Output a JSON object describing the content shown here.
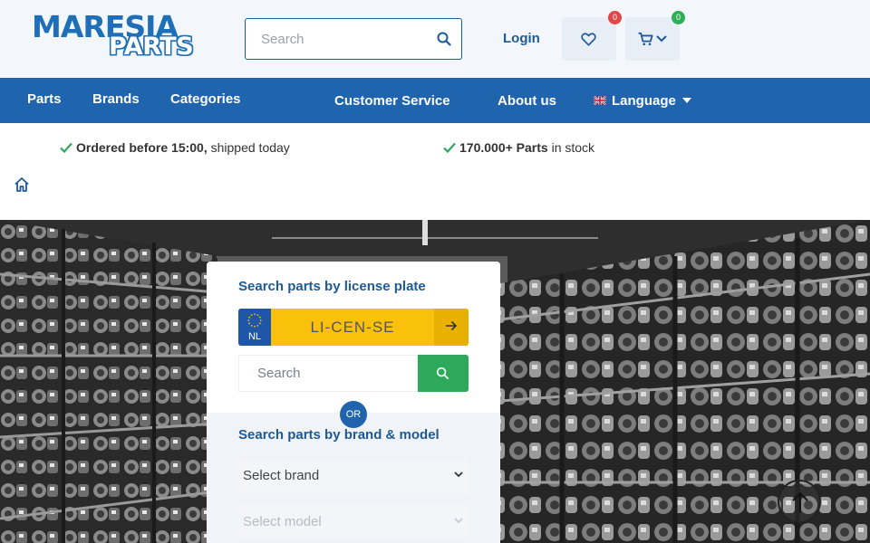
{
  "brand": {
    "word1": "MARESIA",
    "word2": "PARTS"
  },
  "header": {
    "search_placeholder": "Search",
    "login_label": "Login",
    "wishlist_count": "0",
    "cart_count": "0"
  },
  "nav": {
    "items": [
      "Parts",
      "Brands",
      "Categories",
      "Customer Service",
      "About us"
    ],
    "language_label": "Language"
  },
  "usp": [
    {
      "bold": "Ordered before 15:00,",
      "text": " shipped today"
    },
    {
      "bold": "170.000+ Parts",
      "text": " in stock"
    }
  ],
  "panel": {
    "plate_title": "Search parts by license plate",
    "plate_country": "NL",
    "plate_placeholder": "LI-CEN-SE",
    "search_placeholder": "Search",
    "or_label": "OR",
    "brand_title": "Search parts by brand & model",
    "brand_select": "Select brand",
    "model_select": "Select model"
  },
  "colors": {
    "primary": "#1f64ad",
    "accent_green": "#2ea85b",
    "plate_yellow": "#f9c10c",
    "badge_red": "#e04848"
  }
}
